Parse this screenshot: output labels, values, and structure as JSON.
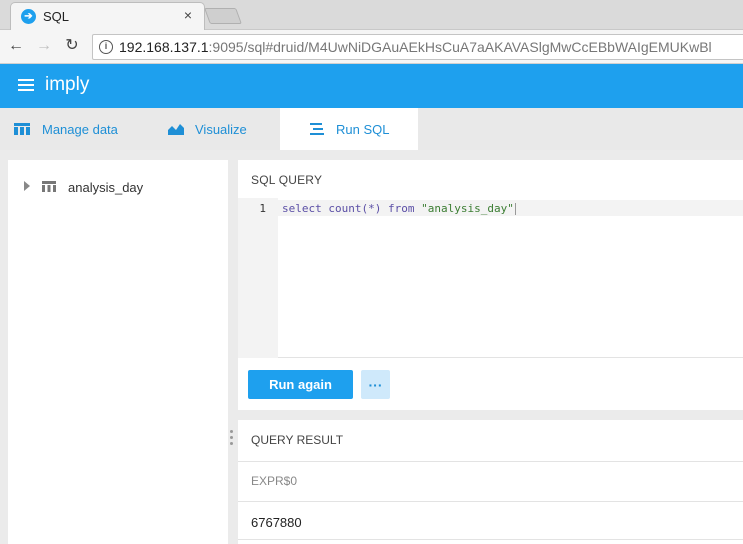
{
  "browser": {
    "tab_title": "SQL",
    "tab_close": "×",
    "url_host": "192.168.137.1",
    "url_rest": ":9095/sql#druid/M4UwNiDGAuAEkHsCuA7aAKAVASlgMwCcEBbWAIgEMUKwBl"
  },
  "app": {
    "brand": "imply"
  },
  "nav_tabs": [
    {
      "label": "Manage data",
      "icon": "table-icon"
    },
    {
      "label": "Visualize",
      "icon": "area-chart-icon"
    },
    {
      "label": "Run SQL",
      "icon": "sql-lines-icon",
      "active": true
    }
  ],
  "sidebar": {
    "items": [
      {
        "label": "analysis_day",
        "icon": "table-icon"
      }
    ]
  },
  "query": {
    "title": "SQL QUERY",
    "line_number": "1",
    "code": {
      "kw1": "select",
      "fn": "count(*)",
      "kw2": "from",
      "table": "\"analysis_day\""
    },
    "run_label": "Run again",
    "more_label": "···"
  },
  "result": {
    "title": "QUERY RESULT",
    "columns": [
      "EXPR$0"
    ],
    "rows": [
      [
        "6767880"
      ]
    ]
  },
  "colors": {
    "brand_blue": "#1ea0ee",
    "link_blue": "#1e8fd6"
  }
}
